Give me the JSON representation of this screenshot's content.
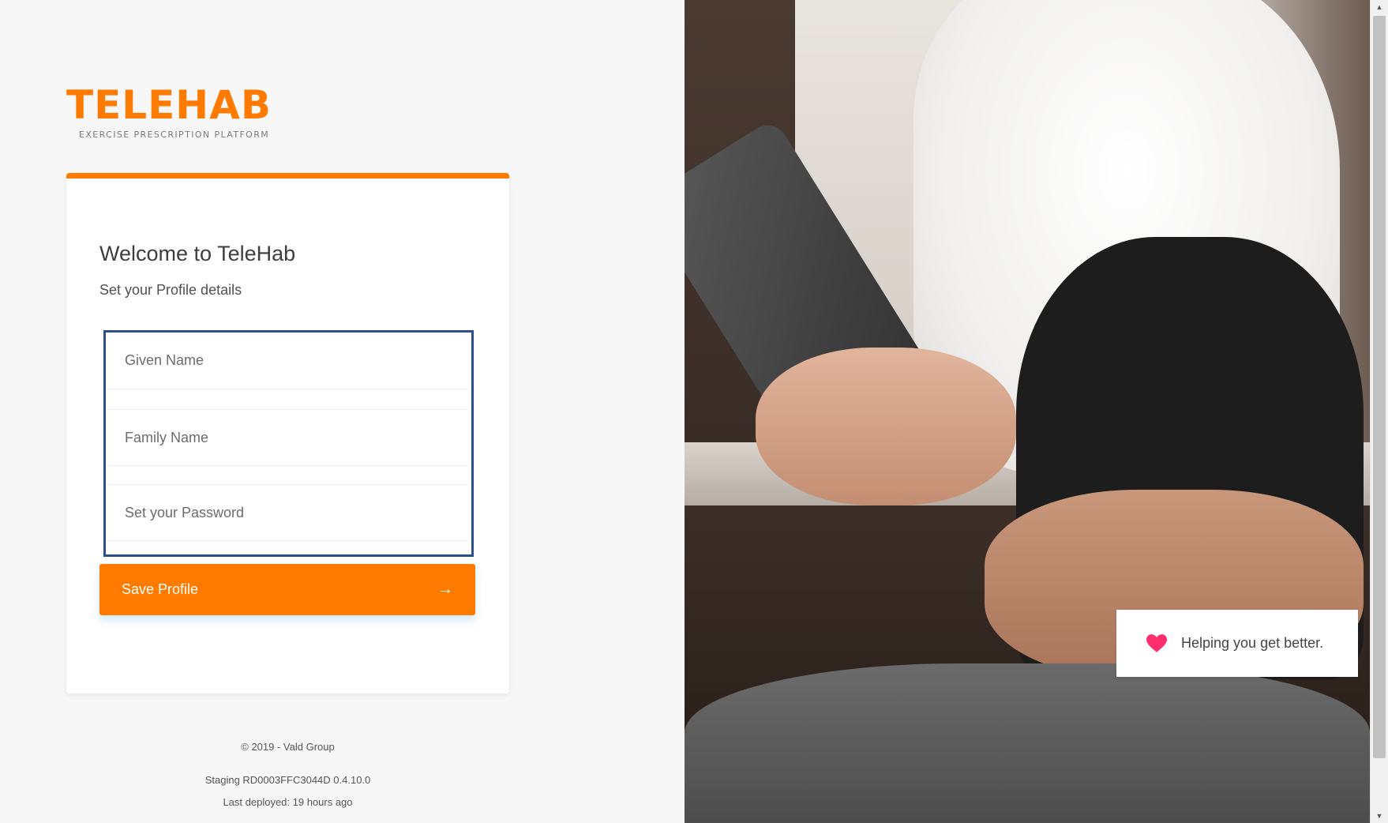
{
  "brand": {
    "logo_text": "TELEHAB",
    "tagline": "EXERCISE PRESCRIPTION PLATFORM",
    "color": "#ff7b00"
  },
  "card": {
    "title": "Welcome to TeleHab",
    "subtitle": "Set your Profile details"
  },
  "form": {
    "given_name": {
      "value": "",
      "placeholder": "Given Name"
    },
    "family_name": {
      "value": "",
      "placeholder": "Family Name"
    },
    "password": {
      "value": "",
      "placeholder": "Set your Password"
    },
    "save_label": "Save Profile",
    "save_arrow": "→"
  },
  "footer": {
    "copyright": "© 2019 - Vald Group",
    "staging": "Staging RD0003FFC3044D 0.4.10.0",
    "deployed": "Last deployed: 19 hours ago"
  },
  "hero": {
    "tagline": "Helping you get better.",
    "icon": "heart-icon",
    "icon_color": "#ff2e6d"
  },
  "scrollbar": {
    "up_icon": "▲",
    "down_icon": "▼"
  }
}
